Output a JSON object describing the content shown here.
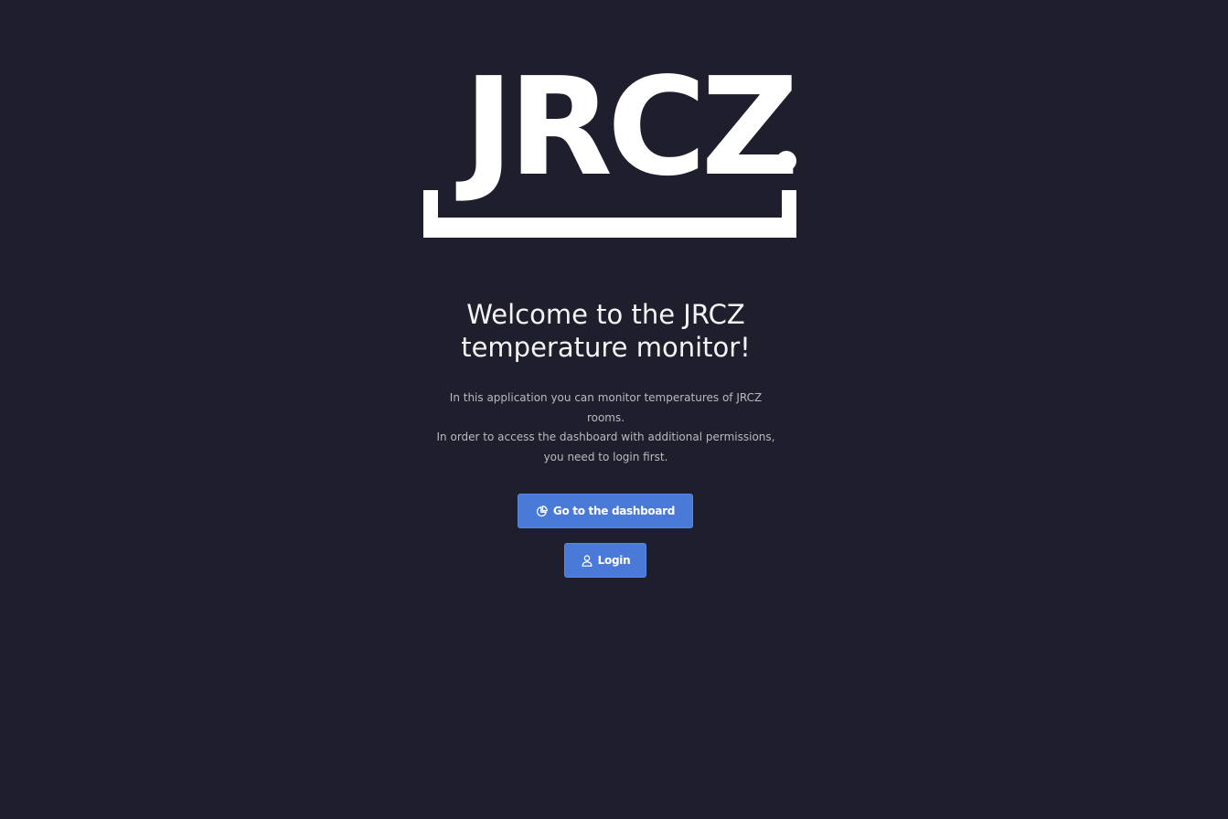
{
  "logo": {
    "text": "JRCZ",
    "dot": ".",
    "color": "#ffffff"
  },
  "welcome": {
    "title_line1": "Welcome to the JRCZ",
    "title_line2": "temperature monitor!"
  },
  "description": {
    "line1": "In this application you can monitor temperatures of JRCZ",
    "line2": "rooms.",
    "line3": "In order to access the dashboard with additional permissions,",
    "line4": "you need to login first."
  },
  "buttons": {
    "dashboard_label": "Go to the dashboard",
    "dashboard_icon": "pie-chart-icon",
    "login_label": "Login",
    "login_icon": "user-icon"
  },
  "colors": {
    "background": "#1f1e2d",
    "button": "#4a7ad8",
    "text": "#f4f4f7",
    "muted_text": "#b9b9c4"
  }
}
